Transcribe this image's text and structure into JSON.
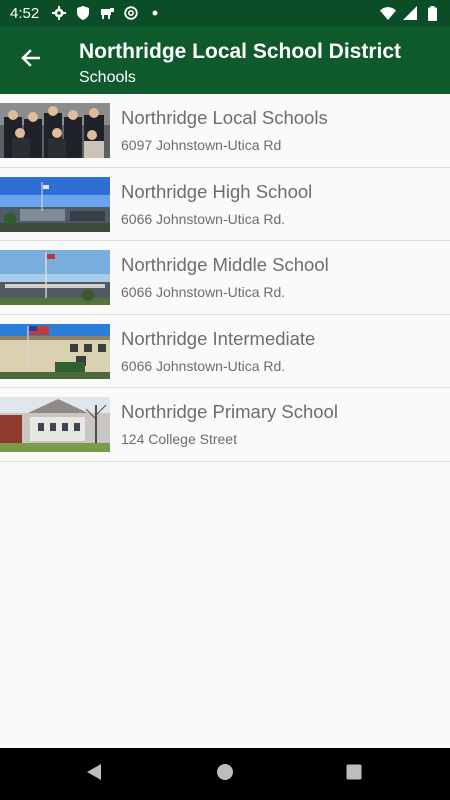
{
  "status_bar": {
    "time": "4:52",
    "icons_left": [
      "gear-icon",
      "shield-icon",
      "cow-icon",
      "at-sign-icon",
      "dot-icon"
    ],
    "icons_right": [
      "wifi-icon",
      "signal-icon",
      "battery-icon"
    ]
  },
  "app_bar": {
    "title": "Northridge Local School District",
    "subtitle": "Schools",
    "back_icon": "arrow-left-icon",
    "background": "#0e5a2c",
    "status_background": "#0b4d26"
  },
  "schools": [
    {
      "name": "Northridge Local Schools",
      "address": "6097 Johnstown-Utica Rd",
      "image": "board-members-photo"
    },
    {
      "name": "Northridge High School",
      "address": "6066 Johnstown-Utica Rd.",
      "image": "high-school-photo"
    },
    {
      "name": "Northridge Middle School",
      "address": "6066 Johnstown-Utica Rd.",
      "image": "middle-school-photo"
    },
    {
      "name": "Northridge Intermediate",
      "address": "6066 Johnstown-Utica Rd.",
      "image": "intermediate-school-photo"
    },
    {
      "name": "Northridge Primary School",
      "address": "124 College Street",
      "image": "primary-school-photo"
    }
  ],
  "nav_bar": {
    "icons": [
      "back-triangle-icon",
      "home-circle-icon",
      "recents-square-icon"
    ]
  }
}
